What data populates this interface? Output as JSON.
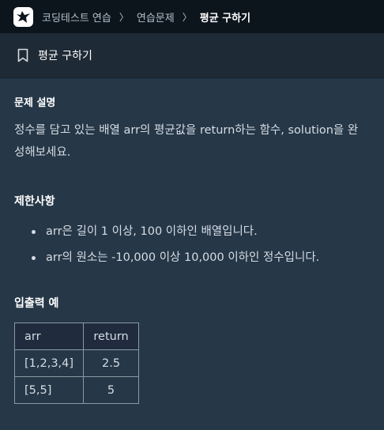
{
  "nav": {
    "crumbs": [
      "코딩테스트 연습",
      "연습문제",
      "평균 구하기"
    ]
  },
  "title": "평균 구하기",
  "description": {
    "heading": "문제 설명",
    "text": "정수를 담고 있는 배열 arr의 평균값을 return하는 함수, solution을 완성해보세요."
  },
  "limits": {
    "heading": "제한사항",
    "items": [
      "arr은 길이 1 이상, 100 이하인 배열입니다.",
      "arr의 원소는 -10,000 이상 10,000 이하인 정수입니다."
    ]
  },
  "io": {
    "heading": "입출력 예",
    "headers": [
      "arr",
      "return"
    ],
    "rows": [
      [
        "[1,2,3,4]",
        "2.5"
      ],
      [
        "[5,5]",
        "5"
      ]
    ]
  },
  "colors": {
    "nav_bg": "#0c151c",
    "title_bg": "#1e2a35",
    "content_bg": "#263747",
    "table_header_bg": "#202b3d"
  }
}
